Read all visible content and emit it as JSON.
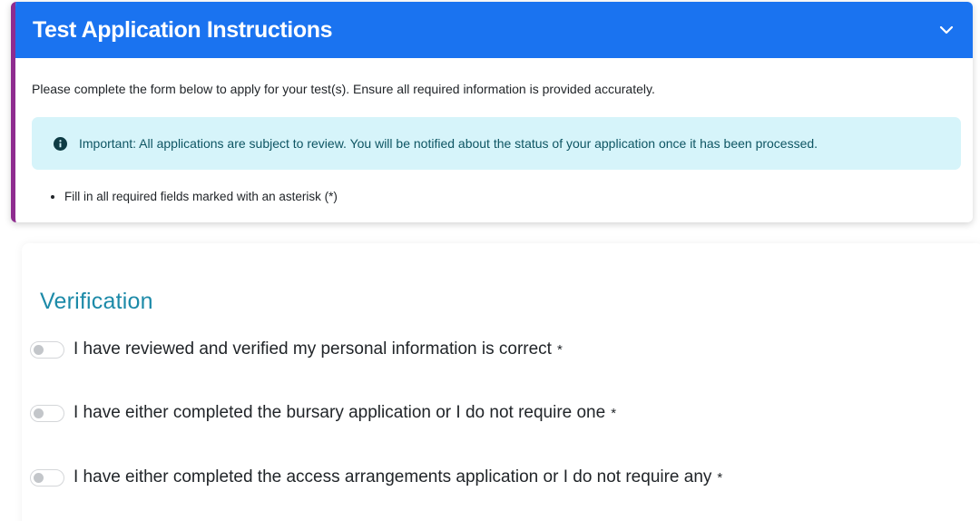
{
  "instructions": {
    "title": "Test Application Instructions",
    "intro": "Please complete the form below to apply for your test(s). Ensure all required information is provided accurately.",
    "alert": "Important: All applications are subject to review. You will be notified about the status of your application once it has been processed.",
    "bullets": [
      "Fill in all required fields marked with an asterisk (*)"
    ],
    "header_color": "#1a73f0",
    "accent_color": "#8e2c8f",
    "toggle_icon": "chevron-down-icon",
    "alert_icon": "info-circle-icon"
  },
  "verification": {
    "title": "Verification",
    "title_color": "#1c8aa8",
    "items": [
      {
        "label": "I have reviewed and verified my personal information is correct",
        "required": "*",
        "checked": false
      },
      {
        "label": "I have either completed the bursary application or I do not require one",
        "required": "*",
        "checked": false
      },
      {
        "label": "I have either completed the access arrangements application or I do not require any",
        "required": "*",
        "checked": false
      }
    ]
  }
}
